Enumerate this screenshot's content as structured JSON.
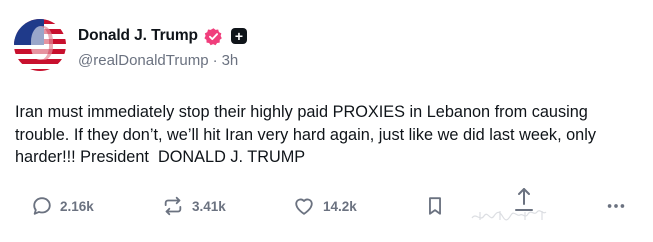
{
  "author": {
    "display_name": "Donald J. Trump",
    "handle": "@realDonaldTrump",
    "separator": "·",
    "time": "3h",
    "verified_badge_color": "#f03e7c",
    "plus_badge_glyph": "+"
  },
  "post": {
    "text": "Iran must immediately stop their highly paid PROXIES in Lebanon from causing trouble. If they don’t, we’ll hit Iran very hard again, just like we did last week, only harder!!! President  DONALD J. TRUMP"
  },
  "actions": {
    "replies": "2.16k",
    "reposts": "3.41k",
    "likes": "14.2k",
    "icons": [
      "reply-icon",
      "repost-icon",
      "like-icon",
      "bookmark-icon",
      "share-icon",
      "more-icon"
    ]
  }
}
